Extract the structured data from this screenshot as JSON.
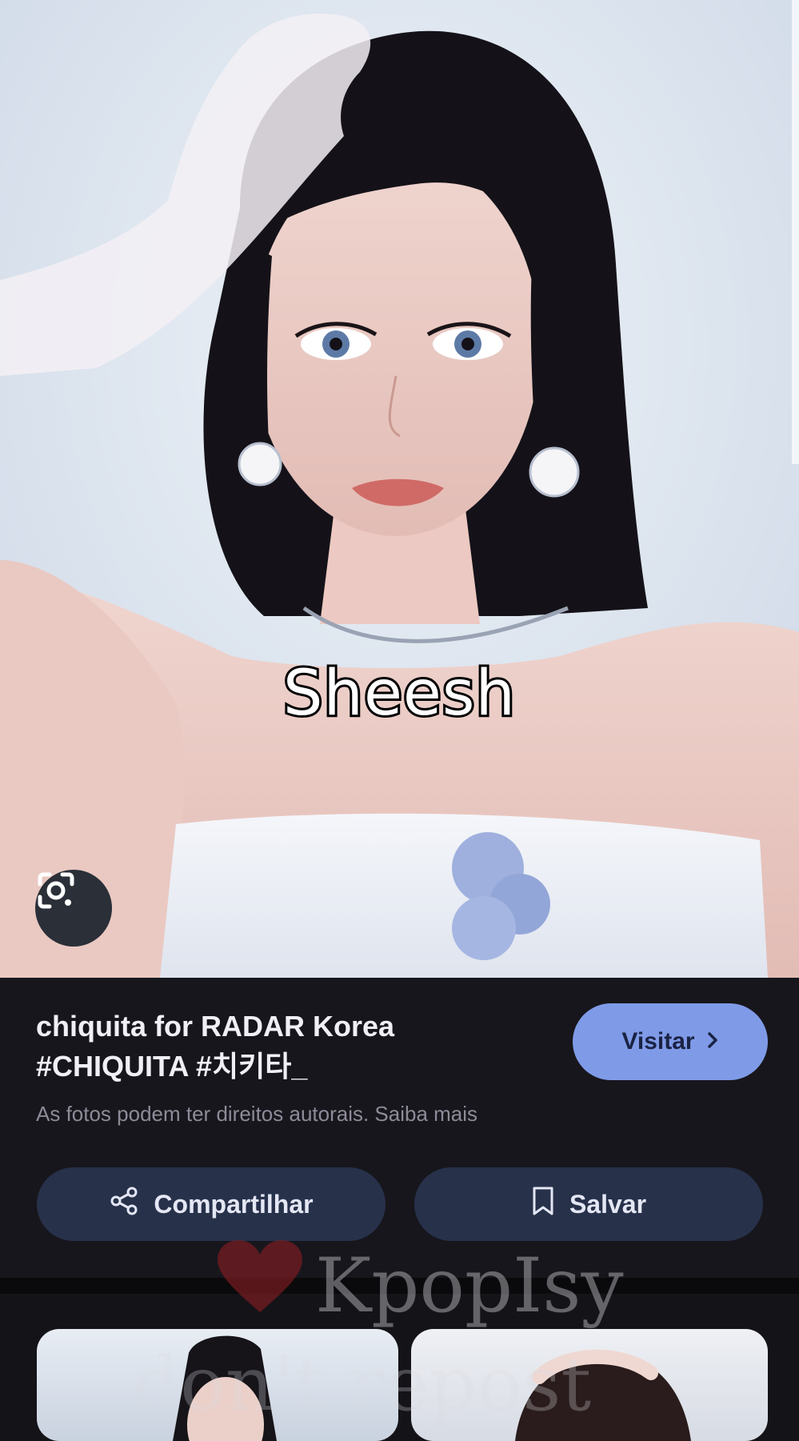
{
  "overlay": {
    "caption": "Sheesh"
  },
  "pin": {
    "title": "chiquita for RADAR Korea #CHIQUITA #치키타_",
    "visit_label": "Visitar",
    "copyright": "As fotos podem ter direitos autorais. Saiba mais",
    "share_label": "Compartilhar",
    "save_label": "Salvar"
  },
  "watermark": {
    "brand": "KpopIsy",
    "notice": "don't repost"
  },
  "icons": {
    "lens": "google-lens-icon",
    "visit": "chevron-right-icon",
    "share": "share-icon",
    "save": "bookmark-icon",
    "heart": "heart-icon"
  },
  "colors": {
    "panel": "#17161c",
    "visit_button": "#7f9be8",
    "action_button": "#27314a"
  }
}
